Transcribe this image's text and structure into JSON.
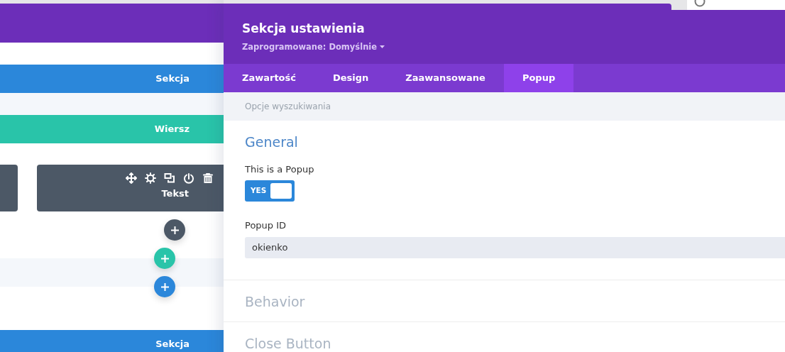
{
  "builder": {
    "items": [
      {
        "kind": "section",
        "label": "Sekcja"
      },
      {
        "kind": "row",
        "label": "Wiersz"
      },
      {
        "kind": "module",
        "label": "Tekst"
      },
      {
        "kind": "add_buttons"
      },
      {
        "kind": "section",
        "label": "Sekcja"
      }
    ]
  },
  "panel": {
    "title": "Sekcja ustawienia",
    "preset": "Zaprogramowane: Domyślnie",
    "tabs": [
      {
        "label": "Zawartość",
        "selected": false
      },
      {
        "label": "Design",
        "selected": false
      },
      {
        "label": "Zaawansowane",
        "selected": false
      },
      {
        "label": "Popup",
        "selected": true
      }
    ],
    "search": {
      "placeholder": "Opcje wyszukiwania"
    },
    "groups": [
      {
        "title": "General",
        "expanded": true,
        "fields": [
          {
            "kind": "toggle",
            "label": "This is a Popup",
            "on": true,
            "on_text": "YES"
          },
          {
            "kind": "text",
            "label": "Popup ID",
            "value": "okienko"
          }
        ]
      },
      {
        "title": "Behavior",
        "expanded": false
      },
      {
        "title": "Close Button",
        "expanded": false
      }
    ]
  }
}
